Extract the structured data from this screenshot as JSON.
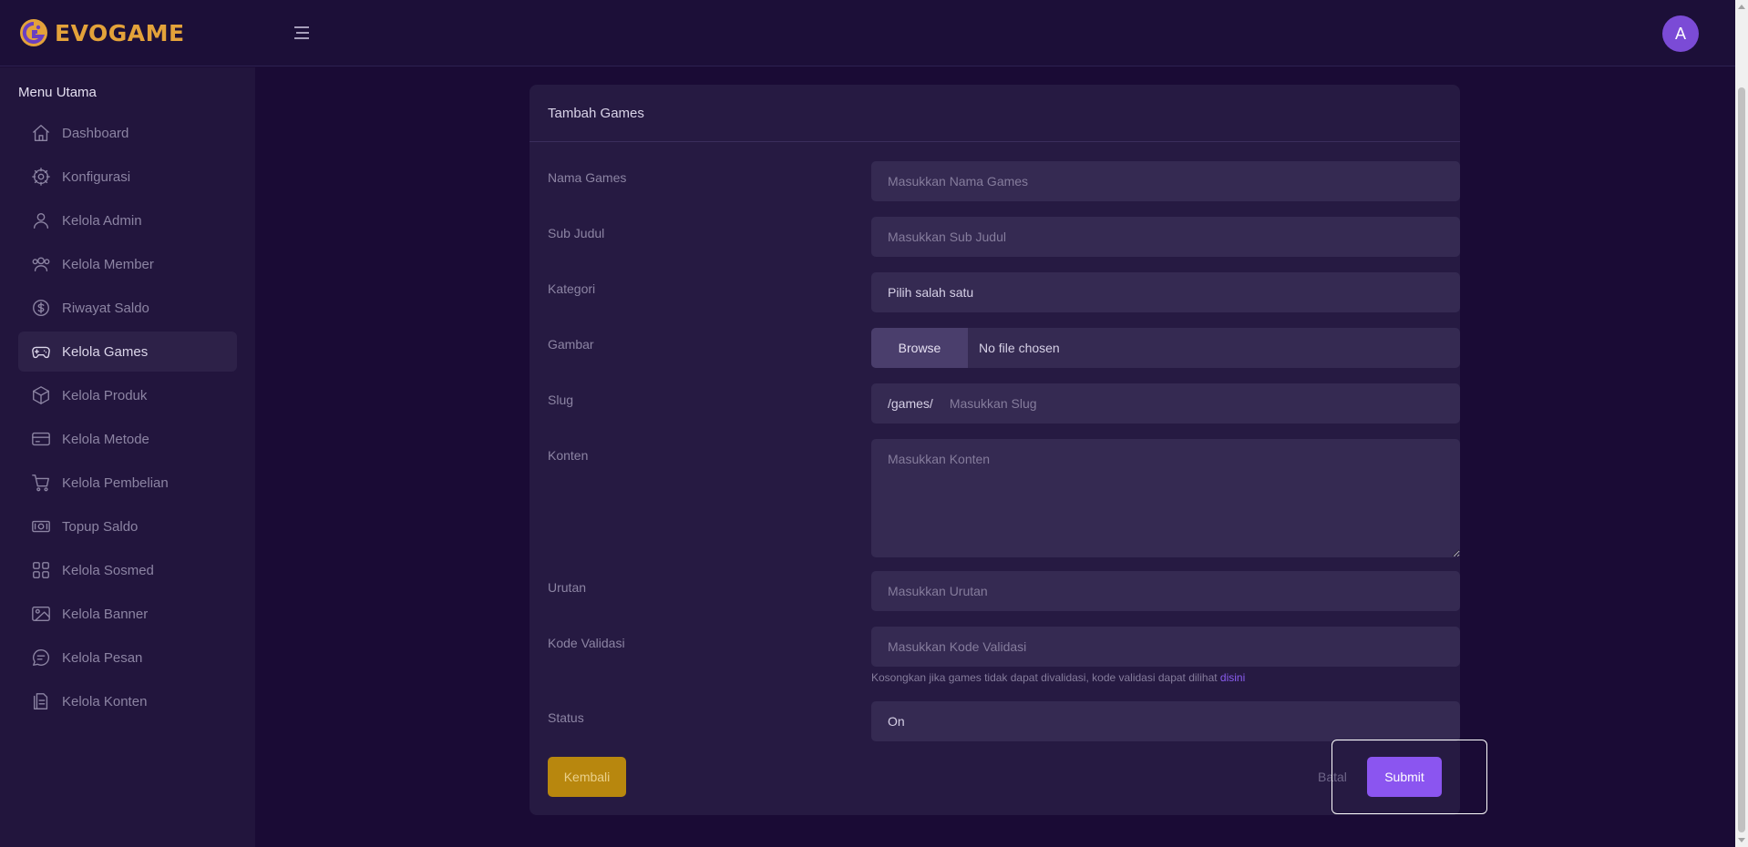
{
  "brand": {
    "name": "EVOGAME",
    "accent": "#e3a23a"
  },
  "user": {
    "avatar_initial": "A"
  },
  "sidebar": {
    "title": "Menu Utama",
    "items": [
      {
        "label": "Dashboard",
        "icon": "home-icon",
        "active": false
      },
      {
        "label": "Konfigurasi",
        "icon": "gear-icon",
        "active": false
      },
      {
        "label": "Kelola Admin",
        "icon": "user-icon",
        "active": false
      },
      {
        "label": "Kelola Member",
        "icon": "users-icon",
        "active": false
      },
      {
        "label": "Riwayat Saldo",
        "icon": "dollar-circle-icon",
        "active": false
      },
      {
        "label": "Kelola Games",
        "icon": "gamepad-icon",
        "active": true
      },
      {
        "label": "Kelola Produk",
        "icon": "box-icon",
        "active": false
      },
      {
        "label": "Kelola Metode",
        "icon": "credit-card-icon",
        "active": false
      },
      {
        "label": "Kelola Pembelian",
        "icon": "cart-icon",
        "active": false
      },
      {
        "label": "Topup Saldo",
        "icon": "cash-icon",
        "active": false
      },
      {
        "label": "Kelola Sosmed",
        "icon": "grid-icon",
        "active": false
      },
      {
        "label": "Kelola Banner",
        "icon": "image-icon",
        "active": false
      },
      {
        "label": "Kelola Pesan",
        "icon": "chat-icon",
        "active": false
      },
      {
        "label": "Kelola Konten",
        "icon": "document-icon",
        "active": false
      }
    ]
  },
  "form": {
    "title": "Tambah Games",
    "fields": {
      "nama": {
        "label": "Nama Games",
        "placeholder": "Masukkan Nama Games"
      },
      "sub_judul": {
        "label": "Sub Judul",
        "placeholder": "Masukkan Sub Judul"
      },
      "kategori": {
        "label": "Kategori",
        "value": "Pilih salah satu"
      },
      "gambar": {
        "label": "Gambar",
        "browse": "Browse",
        "file": "No file chosen"
      },
      "slug": {
        "label": "Slug",
        "prefix": "/games/",
        "placeholder": "Masukkan Slug"
      },
      "konten": {
        "label": "Konten",
        "placeholder": "Masukkan Konten"
      },
      "urutan": {
        "label": "Urutan",
        "placeholder": "Masukkan Urutan"
      },
      "kode": {
        "label": "Kode Validasi",
        "placeholder": "Masukkan Kode Validasi",
        "hint": "Kosongkan jika games tidak dapat divalidasi, kode validasi dapat dilihat ",
        "hint_link": "disini"
      },
      "status": {
        "label": "Status",
        "value": "On"
      }
    },
    "buttons": {
      "back": "Kembali",
      "cancel": "Batal",
      "submit": "Submit"
    }
  }
}
